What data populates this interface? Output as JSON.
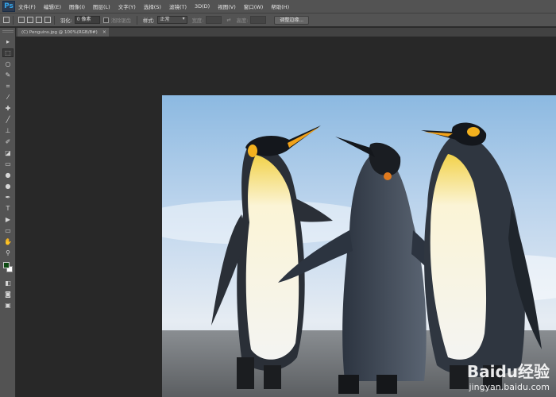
{
  "app": {
    "logo": "Ps",
    "colors": {
      "chrome": "#535353",
      "canvas_bg": "#282828",
      "foreground_color": "#0d4a12",
      "background_color": "#ffffff"
    }
  },
  "menu": [
    "文件(F)",
    "编辑(E)",
    "图像(I)",
    "图层(L)",
    "文字(Y)",
    "选择(S)",
    "滤镜(T)",
    "3D(D)",
    "视图(V)",
    "窗口(W)",
    "帮助(H)"
  ],
  "options": {
    "feather_label": "羽化:",
    "feather_value": "0 像素",
    "antialias_label": "消除锯齿",
    "style_label": "样式:",
    "style_value": "正常",
    "width_label": "宽度:",
    "height_label": "高度:",
    "refine_edge_button": "调整边缘..."
  },
  "document": {
    "tab_title": "(C) Penguins.jpg @ 100%(RGB/8#)",
    "close_glyph": "×"
  },
  "tools": [
    {
      "name": "move-tool-icon",
      "glyph": "▸"
    },
    {
      "name": "marquee-tool-icon",
      "glyph": "⬚"
    },
    {
      "name": "lasso-tool-icon",
      "glyph": "○"
    },
    {
      "name": "quick-select-tool-icon",
      "glyph": "✎"
    },
    {
      "name": "crop-tool-icon",
      "glyph": "⌗"
    },
    {
      "name": "eyedropper-tool-icon",
      "glyph": "⁄"
    },
    {
      "name": "healing-brush-tool-icon",
      "glyph": "✚"
    },
    {
      "name": "brush-tool-icon",
      "glyph": "╱"
    },
    {
      "name": "clone-stamp-tool-icon",
      "glyph": "⊥"
    },
    {
      "name": "history-brush-tool-icon",
      "glyph": "✐"
    },
    {
      "name": "eraser-tool-icon",
      "glyph": "◪"
    },
    {
      "name": "gradient-tool-icon",
      "glyph": "▭"
    },
    {
      "name": "blur-tool-icon",
      "glyph": "●"
    },
    {
      "name": "dodge-tool-icon",
      "glyph": "●"
    },
    {
      "name": "pen-tool-icon",
      "glyph": "✒"
    },
    {
      "name": "type-tool-icon",
      "glyph": "T"
    },
    {
      "name": "path-select-tool-icon",
      "glyph": "▶"
    },
    {
      "name": "rectangle-tool-icon",
      "glyph": "▭"
    },
    {
      "name": "hand-tool-icon",
      "glyph": "✋"
    },
    {
      "name": "zoom-tool-icon",
      "glyph": "⚲"
    },
    {
      "name": "default-colors-icon",
      "glyph": "◧"
    },
    {
      "name": "quick-mask-icon",
      "glyph": "◙"
    },
    {
      "name": "screen-mode-icon",
      "glyph": "▣"
    }
  ],
  "watermark": {
    "line1": "Baidu经验",
    "line2": "jingyan.baidu.com"
  }
}
